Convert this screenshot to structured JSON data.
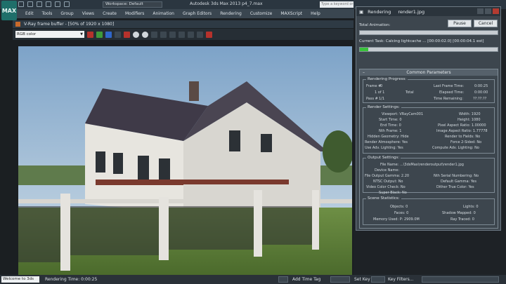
{
  "app": {
    "logo": "MAX",
    "workspace": "Workspace: Default",
    "title": "Autodesk 3ds Max 2013    p4_7.max",
    "search_placeholder": "Type a keyword or phrase"
  },
  "menu": [
    "Edit",
    "Tools",
    "Group",
    "Views",
    "Create",
    "Modifiers",
    "Animation",
    "Graph Editors",
    "Rendering",
    "Customize",
    "MAXScript",
    "Help"
  ],
  "vfb": {
    "title": "V-Ray frame buffer - [50% of 1920 x 1080]",
    "channel": "RGB color"
  },
  "rendering": {
    "title_app": "Rendering",
    "title_file": "render1.jpg",
    "total_animation_label": "Total Animation:",
    "pause_label": "Pause",
    "cancel_label": "Cancel",
    "current_task": "Current Task:  Calcing lightcache ... [00:00:02.0] [00:00:04.1 est]",
    "total_progress": 0,
    "task_progress": 0.06,
    "panel_title": "Common Parameters",
    "progress": {
      "title": "Rendering Progress:",
      "frame_label": "Frame #",
      "frame_value": "0",
      "last_frame_time_label": "Last Frame Time:",
      "last_frame_time_value": "0:00:25",
      "of_label": "1 of 1",
      "total_label": "Total",
      "elapsed_time_label": "Elapsed Time:",
      "elapsed_time_value": "0:00:00",
      "pass_label": "Pass #",
      "pass_value": "1/1",
      "time_remaining_label": "Time Remaining:",
      "time_remaining_value": "??:??:??"
    },
    "render_settings": {
      "title": "Render Settings:",
      "left": [
        "Viewport: VRayCam001",
        "Start Time: 0",
        "End Time: 0",
        "Nth Frame: 1",
        "Hidden Geometry: Hide",
        "Render Atmosphere: Yes",
        "Use Adv. Lighting: Yes"
      ],
      "right": [
        "Width: 1920",
        "Height: 1080",
        "Pixel Aspect Ratio: 1.00000",
        "Image Aspect Ratio: 1.77778",
        "Render to Fields: No",
        "Force 2-Sided: No",
        "Compute Adv. Lighting: No"
      ]
    },
    "output_settings": {
      "title": "Output Settings:",
      "file_name": "File Name: ...\\3dsMax\\renderoutput\\render1.jpg",
      "device_name": "Device Name:",
      "left": [
        "NTSC Output: No",
        "Video Color Check: No",
        "Super Black: No"
      ],
      "right": [
        "Nth Serial Numbering: No",
        "Default Gamma: Yes",
        "Dither True Color: Yes"
      ],
      "gamma": "File Output Gamma: 2.20"
    },
    "scene_statistics": {
      "title": "Scene Statistics:",
      "left": [
        "Objects: 0",
        "Faces: 0",
        "Memory Used: P: 2909.0M"
      ],
      "right": [
        "Lights: 0",
        "Shadow Mapped: 0",
        "Ray Traced: 0"
      ]
    }
  },
  "status": {
    "welcome": "Welcome to 3ds",
    "rendering_time": "Rendering Time: 0:00:25",
    "add_time_tag": "Add Time Tag",
    "set_key": "Set Key",
    "key_filters": "Key Filters..."
  }
}
